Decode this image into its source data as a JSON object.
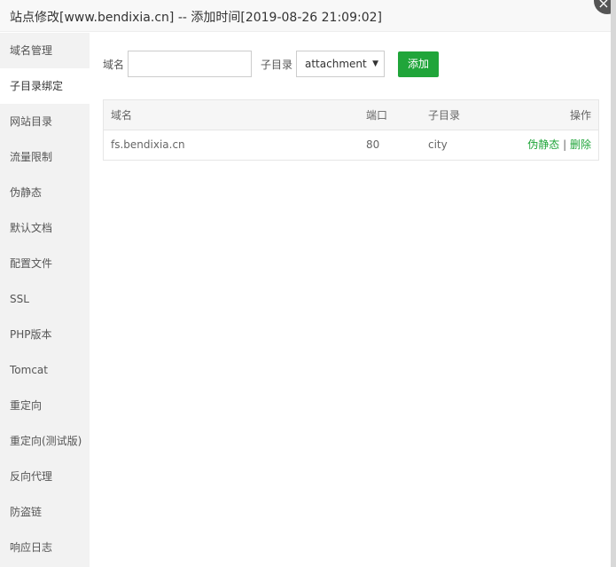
{
  "dialog": {
    "title": "站点修改[www.bendixia.cn] -- 添加时间[2019-08-26 21:09:02]",
    "close_glyph": "×"
  },
  "sidebar": {
    "items": [
      {
        "label": "域名管理"
      },
      {
        "label": "子目录绑定"
      },
      {
        "label": "网站目录"
      },
      {
        "label": "流量限制"
      },
      {
        "label": "伪静态"
      },
      {
        "label": "默认文档"
      },
      {
        "label": "配置文件"
      },
      {
        "label": "SSL"
      },
      {
        "label": "PHP版本"
      },
      {
        "label": "Tomcat"
      },
      {
        "label": "重定向"
      },
      {
        "label": "重定向(测试版)"
      },
      {
        "label": "反向代理"
      },
      {
        "label": "防盗链"
      },
      {
        "label": "响应日志"
      }
    ],
    "active_index": 1
  },
  "form": {
    "domain_label": "域名",
    "domain_value": "",
    "subdir_label": "子目录",
    "subdir_selected": "attachment",
    "add_label": "添加"
  },
  "table": {
    "headers": {
      "domain": "域名",
      "port": "端口",
      "subdir": "子目录",
      "action": "操作"
    },
    "rows": [
      {
        "domain": "fs.bendixia.cn",
        "port": "80",
        "subdir": "city",
        "action_rewrite": "伪静态",
        "separator": "|",
        "action_delete": "删除"
      }
    ]
  },
  "colors": {
    "accent": "#20a53a",
    "sidebar_bg": "#f2f2f2",
    "header_bg": "#f6f6f6"
  }
}
